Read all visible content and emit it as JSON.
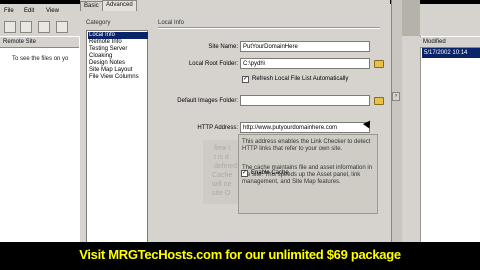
{
  "left_app": {
    "menu": [
      "File",
      "Edit",
      "View"
    ],
    "panel_header": "Remote Site",
    "panel_hint": "To see the files on yo"
  },
  "right_app": {
    "header": "Modified",
    "row_value": "5/17/2002 10:14"
  },
  "dialog": {
    "tabs": [
      "Basic",
      "Advanced"
    ],
    "active_tab": "Advanced",
    "category_label": "Category",
    "categories": [
      "Local Info",
      "Remote Info",
      "Testing Server",
      "Cloaking",
      "Design Notes",
      "Site Map Layout",
      "File View Columns"
    ],
    "selected_category": "Local Info",
    "section_title": "Local Info",
    "site_name_label": "Site Name:",
    "site_name_value": "PutYourDomainHere",
    "local_root_label": "Local Root Folder:",
    "local_root_value": "C:\\pydh\\",
    "refresh_label": "Refresh Local File List Automatically",
    "refresh_checked": true,
    "default_images_label": "Default Images Folder:",
    "default_images_value": "",
    "http_label": "HTTP Address:",
    "http_value": "http://www.putyourdomainhere.com",
    "tooltip_para1": "This address enables the Link Checker to detect HTTP links that refer to your own site.",
    "cache_label": "Enable Cache",
    "cache_checked": true,
    "tooltip_para2": "The cache maintains file and asset information in the site. This speeds up the Asset panel, link management, and Site Map features.",
    "ghost_lines": [
      "fiew t",
      "t is d",
      "defined",
      "Cache",
      "will ne",
      "site O"
    ]
  },
  "banner": {
    "text": "Visit MRGTecHosts.com for our unlimited $69 package",
    "color": "#ffff00"
  },
  "colors": {
    "selection": "#0a246a",
    "dialog_bg": "#d6d3ce"
  }
}
